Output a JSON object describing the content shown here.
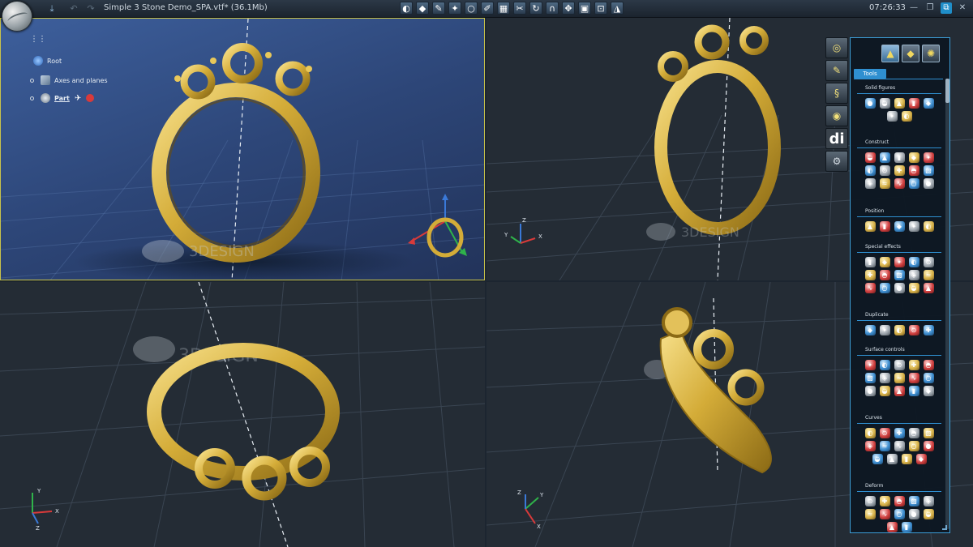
{
  "topbar": {
    "document_title": "Simple 3 Stone Demo_SPA.vtf* (36.1Mb)",
    "clock": "07:26:33",
    "icons": {
      "app_logo": "3design-logo-icon",
      "save": "download-icon",
      "undo": "undo-icon",
      "redo": "redo-icon"
    }
  },
  "tree": {
    "menu_icon": "grid-menu-icon",
    "items": [
      {
        "label": "Root",
        "icon": "globe-icon"
      },
      {
        "label": "Axes and planes",
        "icon": "planes-icon"
      },
      {
        "label": "Part",
        "icon": "part-icon"
      }
    ]
  },
  "axes": {
    "x": "X",
    "y": "Y",
    "z": "Z"
  },
  "panel": {
    "tab_label": "Tools",
    "sections": [
      {
        "title": "Solid figures",
        "count": 7
      },
      {
        "title": "Construct",
        "count": 15
      },
      {
        "title": "Position",
        "count": 5
      },
      {
        "title": "Special effects",
        "count": 15
      },
      {
        "title": "Duplicate",
        "count": 5
      },
      {
        "title": "Surface controls",
        "count": 15
      },
      {
        "title": "Curves",
        "count": 14
      },
      {
        "title": "Deform",
        "count": 12
      }
    ]
  },
  "side_tabs": {
    "text_tab": "di"
  },
  "colors": {
    "accent": "#2f8fd0",
    "gold": "#d8b340",
    "active_viewport_border": "#c8c24a"
  }
}
